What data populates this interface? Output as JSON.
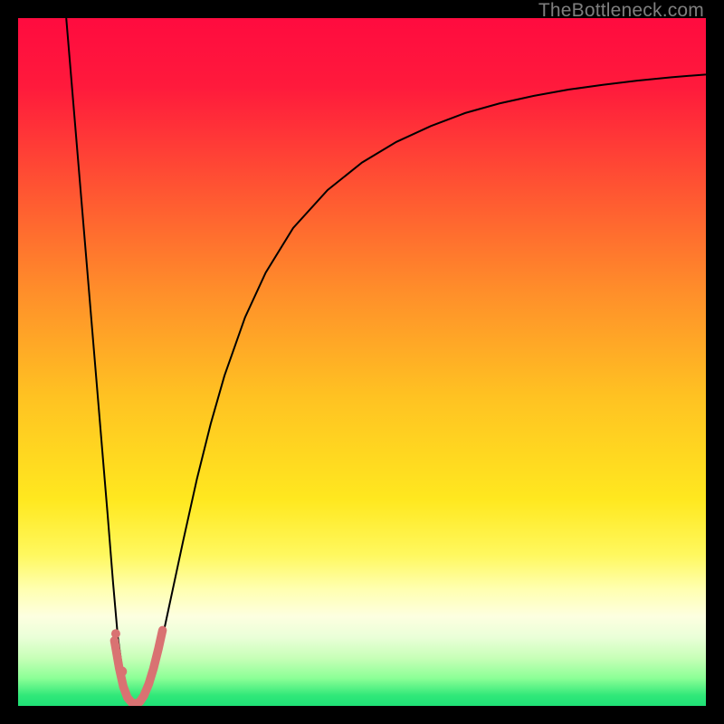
{
  "watermark": "TheBottleneck.com",
  "chart_data": {
    "type": "line",
    "title": "",
    "xlabel": "",
    "ylabel": "",
    "xlim": [
      0,
      100
    ],
    "ylim": [
      0,
      100
    ],
    "gradient_stops": [
      {
        "offset": 0.0,
        "color": "#ff0b3f"
      },
      {
        "offset": 0.1,
        "color": "#ff1a3c"
      },
      {
        "offset": 0.25,
        "color": "#ff5532"
      },
      {
        "offset": 0.4,
        "color": "#ff8f2a"
      },
      {
        "offset": 0.55,
        "color": "#ffc222"
      },
      {
        "offset": 0.7,
        "color": "#ffe81f"
      },
      {
        "offset": 0.78,
        "color": "#fff85e"
      },
      {
        "offset": 0.83,
        "color": "#ffffb0"
      },
      {
        "offset": 0.87,
        "color": "#fdffe0"
      },
      {
        "offset": 0.9,
        "color": "#eaffd8"
      },
      {
        "offset": 0.93,
        "color": "#c8ffb8"
      },
      {
        "offset": 0.96,
        "color": "#8bff96"
      },
      {
        "offset": 0.985,
        "color": "#30e879"
      },
      {
        "offset": 1.0,
        "color": "#1fe076"
      }
    ],
    "series": [
      {
        "name": "black-curve-left",
        "stroke": "#000000",
        "width": 2.0,
        "points": [
          {
            "x": 7.0,
            "y": 100.0
          },
          {
            "x": 8.0,
            "y": 88.0
          },
          {
            "x": 9.0,
            "y": 76.0
          },
          {
            "x": 10.0,
            "y": 64.0
          },
          {
            "x": 11.0,
            "y": 52.0
          },
          {
            "x": 12.0,
            "y": 40.0
          },
          {
            "x": 13.0,
            "y": 28.0
          },
          {
            "x": 13.8,
            "y": 18.0
          },
          {
            "x": 14.5,
            "y": 10.0
          },
          {
            "x": 15.2,
            "y": 5.0
          },
          {
            "x": 15.8,
            "y": 2.0
          },
          {
            "x": 16.2,
            "y": 0.8
          },
          {
            "x": 16.6,
            "y": 0.3
          },
          {
            "x": 17.0,
            "y": 0.2
          }
        ]
      },
      {
        "name": "black-curve-right",
        "stroke": "#000000",
        "width": 2.0,
        "points": [
          {
            "x": 17.0,
            "y": 0.2
          },
          {
            "x": 17.6,
            "y": 0.5
          },
          {
            "x": 18.2,
            "y": 1.2
          },
          {
            "x": 19.0,
            "y": 3.0
          },
          {
            "x": 20.0,
            "y": 6.0
          },
          {
            "x": 21.0,
            "y": 10.0
          },
          {
            "x": 22.5,
            "y": 17.0
          },
          {
            "x": 24.0,
            "y": 24.0
          },
          {
            "x": 26.0,
            "y": 33.0
          },
          {
            "x": 28.0,
            "y": 41.0
          },
          {
            "x": 30.0,
            "y": 48.0
          },
          {
            "x": 33.0,
            "y": 56.5
          },
          {
            "x": 36.0,
            "y": 63.0
          },
          {
            "x": 40.0,
            "y": 69.5
          },
          {
            "x": 45.0,
            "y": 75.0
          },
          {
            "x": 50.0,
            "y": 79.0
          },
          {
            "x": 55.0,
            "y": 82.0
          },
          {
            "x": 60.0,
            "y": 84.3
          },
          {
            "x": 65.0,
            "y": 86.2
          },
          {
            "x": 70.0,
            "y": 87.6
          },
          {
            "x": 75.0,
            "y": 88.7
          },
          {
            "x": 80.0,
            "y": 89.6
          },
          {
            "x": 85.0,
            "y": 90.3
          },
          {
            "x": 90.0,
            "y": 90.9
          },
          {
            "x": 95.0,
            "y": 91.4
          },
          {
            "x": 100.0,
            "y": 91.8
          }
        ]
      },
      {
        "name": "red-curve",
        "stroke": "#d97272",
        "width": 9.5,
        "linecap": "round",
        "points": [
          {
            "x": 14.0,
            "y": 9.5
          },
          {
            "x": 14.7,
            "y": 5.5
          },
          {
            "x": 15.3,
            "y": 2.8
          },
          {
            "x": 15.9,
            "y": 1.2
          },
          {
            "x": 16.5,
            "y": 0.5
          },
          {
            "x": 17.1,
            "y": 0.3
          },
          {
            "x": 17.7,
            "y": 0.6
          },
          {
            "x": 18.3,
            "y": 1.5
          },
          {
            "x": 19.0,
            "y": 3.2
          },
          {
            "x": 19.7,
            "y": 5.5
          },
          {
            "x": 20.4,
            "y": 8.3
          },
          {
            "x": 21.0,
            "y": 11.0
          }
        ]
      }
    ],
    "markers": [
      {
        "name": "red-dot-upper",
        "x": 14.2,
        "y": 10.5,
        "r": 5.0,
        "color": "#d97272"
      },
      {
        "name": "red-dot-lower",
        "x": 15.1,
        "y": 5.0,
        "r": 5.5,
        "color": "#d97272"
      }
    ]
  }
}
